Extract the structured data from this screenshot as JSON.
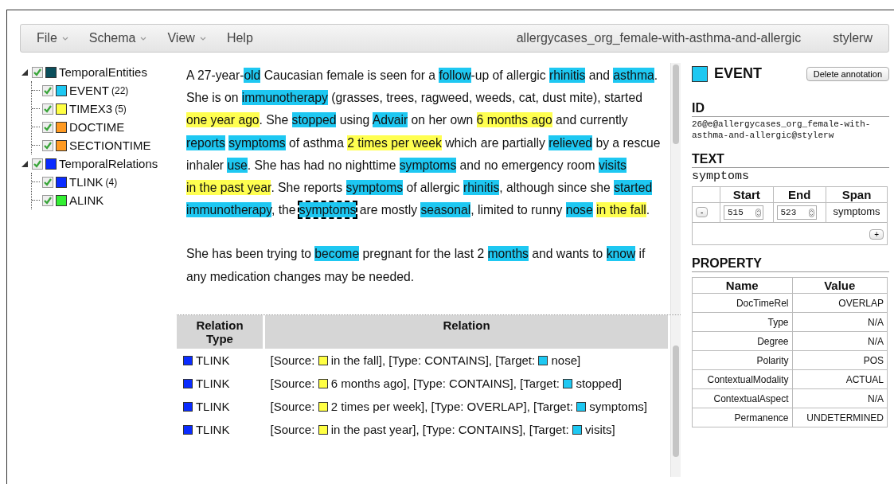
{
  "menu": {
    "items": [
      {
        "label": "File",
        "has_dropdown": true
      },
      {
        "label": "Schema",
        "has_dropdown": true
      },
      {
        "label": "View",
        "has_dropdown": true
      },
      {
        "label": "Help",
        "has_dropdown": false
      }
    ],
    "document_name": "allergycases_org_female-with-asthma-and-allergic",
    "user": "stylerw"
  },
  "tree": [
    {
      "label": "TemporalEntities",
      "color": "#0b4f5c",
      "checked": true,
      "expanded": true,
      "children": [
        {
          "label": "EVENT",
          "count": "(22)",
          "color": "#1ec8f2",
          "checked": true
        },
        {
          "label": "TIMEX3",
          "count": "(5)",
          "color": "#ffff44",
          "checked": true
        },
        {
          "label": "DOCTIME",
          "color": "#ff9a22",
          "checked": true
        },
        {
          "label": "SECTIONTIME",
          "color": "#ff9a22",
          "checked": true
        }
      ]
    },
    {
      "label": "TemporalRelations",
      "color": "#0a2cff",
      "checked": true,
      "expanded": true,
      "children": [
        {
          "label": "TLINK",
          "count": "(4)",
          "color": "#0a2cff",
          "checked": true
        },
        {
          "label": "ALINK",
          "color": "#33ee33",
          "checked": true
        }
      ]
    }
  ],
  "document": {
    "paragraphs": [
      [
        {
          "kind": "plain",
          "text": "A 27-year-"
        },
        {
          "kind": "event",
          "text": "old",
          "selected": false
        },
        {
          "kind": "plain",
          "text": " Caucasian female is seen for a "
        },
        {
          "kind": "event",
          "text": "follow",
          "selected": false
        },
        {
          "kind": "plain",
          "text": "-up of allergic "
        },
        {
          "kind": "event",
          "text": "rhinitis",
          "selected": false
        },
        {
          "kind": "plain",
          "text": " and "
        },
        {
          "kind": "event",
          "text": "asthma",
          "selected": false
        },
        {
          "kind": "plain",
          "text": ". She is on "
        },
        {
          "kind": "event",
          "text": "immunotherapy",
          "selected": false
        },
        {
          "kind": "plain",
          "text": " (grasses, trees, ragweed, weeds, cat, dust mite), started "
        },
        {
          "kind": "timex",
          "text": "one year ago",
          "selected": false
        },
        {
          "kind": "plain",
          "text": ". She "
        },
        {
          "kind": "event",
          "text": "stopped",
          "selected": false
        },
        {
          "kind": "plain",
          "text": " using "
        },
        {
          "kind": "event",
          "text": "Advair",
          "selected": false
        },
        {
          "kind": "plain",
          "text": " on her own "
        },
        {
          "kind": "timex",
          "text": "6 months ago",
          "selected": false
        },
        {
          "kind": "plain",
          "text": " and currently "
        },
        {
          "kind": "event",
          "text": "reports",
          "selected": false,
          "space_after": true
        },
        {
          "kind": "event",
          "text": "symptoms",
          "selected": false
        },
        {
          "kind": "plain",
          "text": " of asthma "
        },
        {
          "kind": "timex",
          "text": "2 times per week",
          "selected": false
        },
        {
          "kind": "plain",
          "text": " which are partially "
        },
        {
          "kind": "event",
          "text": "relieved",
          "selected": false
        },
        {
          "kind": "plain",
          "text": " by a rescue inhaler "
        },
        {
          "kind": "event",
          "text": "use",
          "selected": false
        },
        {
          "kind": "plain",
          "text": ". She has had no nighttime "
        },
        {
          "kind": "event",
          "text": "symptoms",
          "selected": false
        },
        {
          "kind": "plain",
          "text": " and no emergency room "
        },
        {
          "kind": "event",
          "text": "visits",
          "selected": false,
          "space_after": true
        },
        {
          "kind": "timex",
          "text": "in the past year",
          "selected": false
        },
        {
          "kind": "plain",
          "text": ". She reports "
        },
        {
          "kind": "event",
          "text": "symptoms",
          "selected": false
        },
        {
          "kind": "plain",
          "text": " of allergic "
        },
        {
          "kind": "event",
          "text": "rhinitis",
          "selected": false
        },
        {
          "kind": "plain",
          "text": ", although since she "
        },
        {
          "kind": "event",
          "text": "started",
          "selected": false,
          "space_after": true
        },
        {
          "kind": "event",
          "text": "immunotherapy",
          "selected": false
        },
        {
          "kind": "plain",
          "text": ", the "
        },
        {
          "kind": "event",
          "text": "symptoms",
          "selected": true
        },
        {
          "kind": "plain",
          "text": " are mostly "
        },
        {
          "kind": "event",
          "text": "seasonal",
          "selected": false
        },
        {
          "kind": "plain",
          "text": ", limited to runny "
        },
        {
          "kind": "event",
          "text": "nose",
          "selected": false,
          "space_after": true
        },
        {
          "kind": "timex",
          "text": "in the fall",
          "selected": false
        },
        {
          "kind": "plain",
          "text": "."
        }
      ],
      [
        {
          "kind": "plain",
          "text": "She has been trying to "
        },
        {
          "kind": "event",
          "text": "become",
          "selected": false
        },
        {
          "kind": "plain",
          "text": " pregnant for the last 2 "
        },
        {
          "kind": "event",
          "text": "months",
          "selected": false
        },
        {
          "kind": "plain",
          "text": " and wants to "
        },
        {
          "kind": "event",
          "text": "know",
          "selected": false
        },
        {
          "kind": "plain",
          "text": " if any medication changes may be needed."
        }
      ]
    ]
  },
  "relations": {
    "columns": [
      "Relation Type",
      "Relation"
    ],
    "rows": [
      {
        "type": {
          "label": "TLINK",
          "color": "#0a2cff"
        },
        "relation": [
          {
            "kind": "text",
            "text": "[Source: "
          },
          {
            "kind": "swatch",
            "color": "#ffff44"
          },
          {
            "kind": "text",
            "text": "in the fall], [Type: CONTAINS], [Target: "
          },
          {
            "kind": "swatch",
            "color": "#1ec8f2"
          },
          {
            "kind": "text",
            "text": "nose]"
          }
        ]
      },
      {
        "type": {
          "label": "TLINK",
          "color": "#0a2cff"
        },
        "relation": [
          {
            "kind": "text",
            "text": "[Source: "
          },
          {
            "kind": "swatch",
            "color": "#ffff44"
          },
          {
            "kind": "text",
            "text": "6 months ago], [Type: CONTAINS], [Target: "
          },
          {
            "kind": "swatch",
            "color": "#1ec8f2"
          },
          {
            "kind": "text",
            "text": "stopped]"
          }
        ]
      },
      {
        "type": {
          "label": "TLINK",
          "color": "#0a2cff"
        },
        "relation": [
          {
            "kind": "text",
            "text": "[Source: "
          },
          {
            "kind": "swatch",
            "color": "#ffff44"
          },
          {
            "kind": "text",
            "text": "2 times per week], [Type: OVERLAP], [Target: "
          },
          {
            "kind": "swatch",
            "color": "#1ec8f2"
          },
          {
            "kind": "text",
            "text": "symptoms]"
          }
        ]
      },
      {
        "type": {
          "label": "TLINK",
          "color": "#0a2cff"
        },
        "relation": [
          {
            "kind": "text",
            "text": "[Source: "
          },
          {
            "kind": "swatch",
            "color": "#ffff44"
          },
          {
            "kind": "text",
            "text": "in the past year], [Type: CONTAINS], [Target: "
          },
          {
            "kind": "swatch",
            "color": "#1ec8f2"
          },
          {
            "kind": "text",
            "text": "visits]"
          }
        ]
      }
    ]
  },
  "annotation": {
    "type": "EVENT",
    "color": "#1ec8f2",
    "delete_button": "Delete annotation",
    "id_heading": "ID",
    "id": "26@e@allergycases_org_female-with-asthma-and-allergic@stylerw",
    "text_heading": "TEXT",
    "text": "symptoms",
    "spans": {
      "columns": [
        "Start",
        "End",
        "Span"
      ],
      "rows": [
        {
          "remove": "-",
          "start": "515",
          "end": "523",
          "span": "symptoms"
        }
      ],
      "add": "+"
    },
    "property_heading": "PROPERTY",
    "property_columns": [
      "Name",
      "Value"
    ],
    "properties": [
      {
        "name": "DocTimeRel",
        "value": "OVERLAP"
      },
      {
        "name": "Type",
        "value": "N/A"
      },
      {
        "name": "Degree",
        "value": "N/A"
      },
      {
        "name": "Polarity",
        "value": "POS"
      },
      {
        "name": "ContextualModality",
        "value": "ACTUAL"
      },
      {
        "name": "ContextualAspect",
        "value": "N/A"
      },
      {
        "name": "Permanence",
        "value": "UNDETERMINED"
      }
    ]
  }
}
